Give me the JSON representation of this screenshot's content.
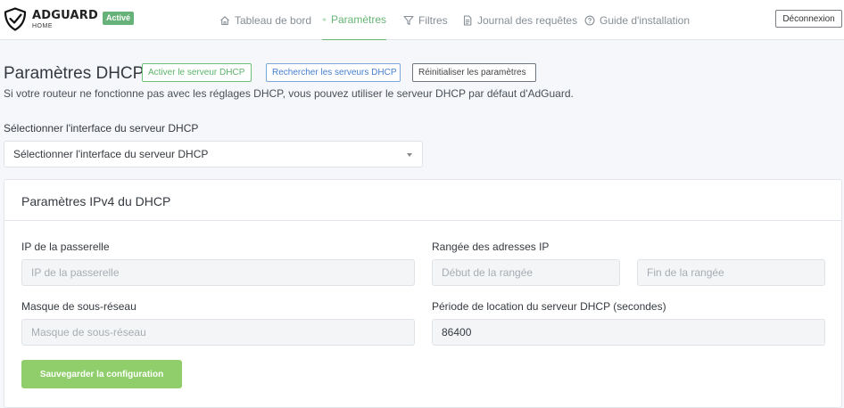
{
  "brand": {
    "title": "ADGUARD",
    "subtitle": "HOME",
    "status_badge": "Activé"
  },
  "nav": {
    "dashboard": "Tableau de bord",
    "settings": "Paramètres",
    "filters": "Filtres",
    "query_log": "Journal des requêtes",
    "setup_guide": "Guide d'installation",
    "active": "settings"
  },
  "logout_label": "Déconnexion",
  "page": {
    "title": "Paramètres DHCP",
    "enable_button": "Activer le serveur DHCP",
    "search_button": "Rechercher les serveurs DHCP",
    "reset_button": "Réinitialiser les paramètres",
    "description": "Si votre routeur ne fonctionne pas avec les réglages DHCP, vous pouvez utiliser le serveur DHCP par défaut d'AdGuard."
  },
  "interface": {
    "label": "Sélectionner l'interface du serveur DHCP",
    "selected": "Sélectionner l'interface du serveur DHCP"
  },
  "ipv4": {
    "title": "Paramètres IPv4 du DHCP",
    "gateway_label": "IP de la passerelle",
    "gateway_placeholder": "IP de la passerelle",
    "gateway_value": "",
    "range_label": "Rangée des adresses IP",
    "range_start_placeholder": "Début de la rangée",
    "range_end_placeholder": "Fin de la rangée",
    "subnet_label": "Masque de sous-réseau",
    "subnet_placeholder": "Masque de sous-réseau",
    "lease_label": "Période de location du serveur DHCP (secondes)",
    "lease_value": "86400",
    "save_button": "Sauvegarder la configuration"
  },
  "colors": {
    "accent": "#66b574",
    "badge": "#67b279",
    "save_button": "#8fce6a",
    "link_blue": "#467fcf"
  },
  "icons": {
    "logo": "shield-check-icon",
    "dashboard": "home-icon",
    "settings": "gear-icon",
    "filters": "filter-icon",
    "query_log": "document-icon",
    "setup_guide": "help-circle-icon",
    "select_caret": "caret-down-icon"
  }
}
